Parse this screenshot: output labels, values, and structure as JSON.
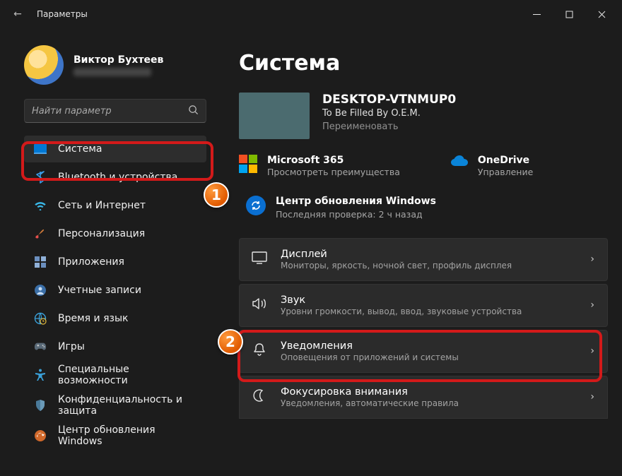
{
  "window": {
    "title": "Параметры"
  },
  "profile": {
    "name": "Виктор Бухтеев"
  },
  "search": {
    "placeholder": "Найти параметр"
  },
  "sidebar": {
    "items": [
      {
        "label": "Система",
        "selected": true
      },
      {
        "label": "Bluetooth и устройства"
      },
      {
        "label": "Сеть и Интернет"
      },
      {
        "label": "Персонализация"
      },
      {
        "label": "Приложения"
      },
      {
        "label": "Учетные записи"
      },
      {
        "label": "Время и язык"
      },
      {
        "label": "Игры"
      },
      {
        "label": "Специальные возможности"
      },
      {
        "label": "Конфиденциальность и защита"
      },
      {
        "label": "Центр обновления Windows"
      }
    ]
  },
  "main": {
    "heading": "Система",
    "pc": {
      "name": "DESKTOP-VTNMUP0",
      "oem": "To Be Filled By O.E.M.",
      "rename": "Переименовать"
    },
    "services": {
      "m365": {
        "title": "Microsoft 365",
        "sub": "Просмотреть преимущества"
      },
      "onedrive": {
        "title": "OneDrive",
        "sub": "Управление"
      }
    },
    "update": {
      "title": "Центр обновления Windows",
      "sub": "Последняя проверка: 2 ч назад"
    },
    "cards": [
      {
        "title": "Дисплей",
        "sub": "Мониторы, яркость, ночной свет, профиль дисплея"
      },
      {
        "title": "Звук",
        "sub": "Уровни громкости, вывод, ввод, звуковые устройства"
      },
      {
        "title": "Уведомления",
        "sub": "Оповещения от приложений и системы"
      },
      {
        "title": "Фокусировка внимания",
        "sub": "Уведомления, автоматические правила"
      }
    ]
  },
  "annotations": {
    "badge1": "1",
    "badge2": "2"
  }
}
